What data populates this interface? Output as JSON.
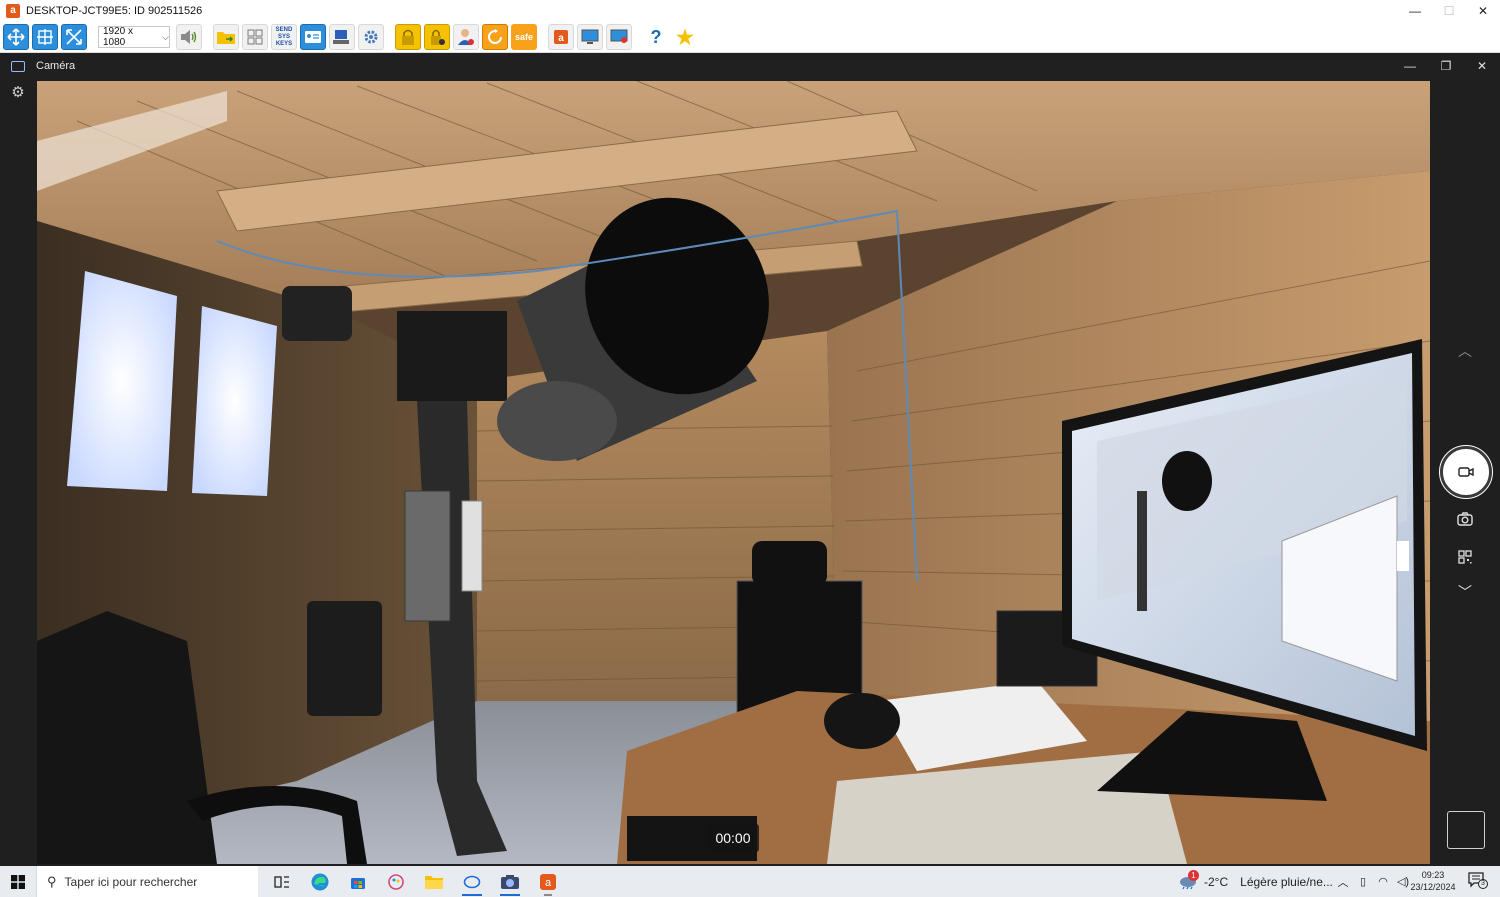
{
  "remote_window": {
    "title": "DESKTOP-JCT99E5: ID 902511526",
    "controls": {
      "minimize": "—",
      "maximize": "☐",
      "close": "✕"
    },
    "toolbar": {
      "resolution": "1920 x 1080",
      "send_keys_label": "SEND SYS KEYS",
      "safe_label": "safe",
      "help_label": "?",
      "star_label": "★"
    }
  },
  "camera_window": {
    "title": "Caméra",
    "controls": {
      "minimize": "—",
      "restore": "❐",
      "close": "✕"
    },
    "timer": "00:00"
  },
  "taskbar": {
    "search_placeholder": "Taper ici pour rechercher",
    "weather": {
      "temp": "-2°C",
      "desc": "Légère pluie/ne...",
      "badge": "1"
    },
    "clock": {
      "time": "09:23",
      "date": "23/12/2024"
    },
    "notification_count": "3"
  },
  "colors": {
    "accent_blue": "#2d8fdc",
    "camera_bg": "#1f1f1f",
    "taskbar_bg": "#e8ecf1"
  }
}
